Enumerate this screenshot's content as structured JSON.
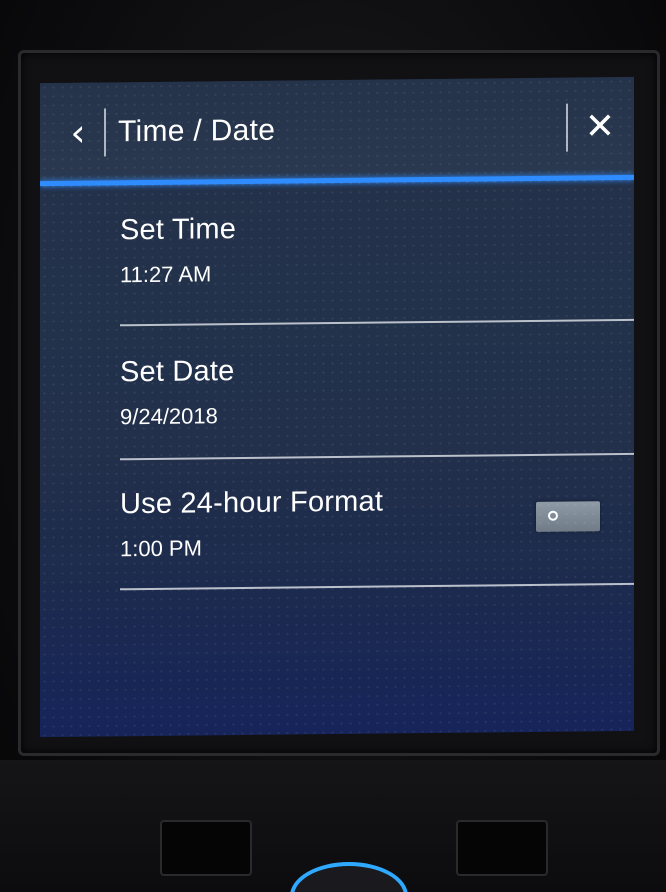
{
  "header": {
    "back_glyph": "‹",
    "title": "Time / Date",
    "close_glyph": "✕"
  },
  "settings": {
    "items": [
      {
        "label": "Set Time",
        "value": "11:27 AM"
      },
      {
        "label": "Set Date",
        "value": "9/24/2018"
      },
      {
        "label": "Use 24-hour Format",
        "value": "1:00 PM",
        "toggle": "off"
      }
    ]
  },
  "theme": {
    "accent": "#2f8cff",
    "text": "#ffffff",
    "screen_background": "#22304b"
  },
  "icons": {
    "back": "chevron-left-icon",
    "close": "close-icon",
    "toggle_knob": "toggle-knob-icon"
  }
}
